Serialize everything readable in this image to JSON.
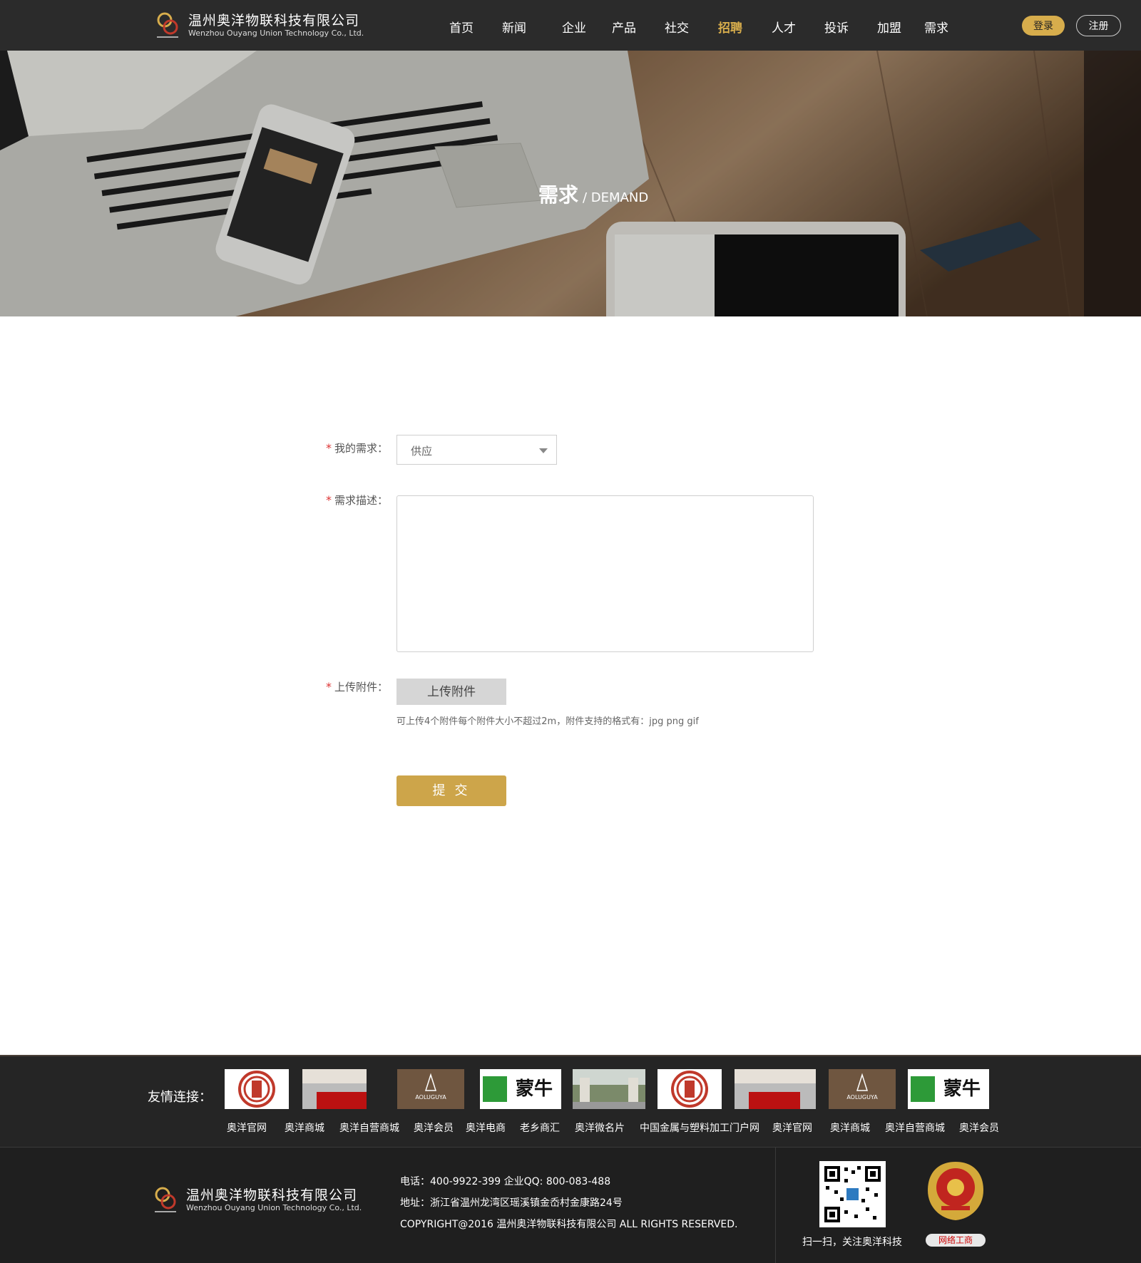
{
  "header": {
    "company_cn": "温州奥洋物联科技有限公司",
    "company_en": "Wenzhou Ouyang Union Technology Co., Ltd.",
    "nav": [
      {
        "label": "首页",
        "active": false
      },
      {
        "label": "新闻",
        "active": false
      },
      {
        "label": "企业",
        "active": false
      },
      {
        "label": "产品",
        "active": false
      },
      {
        "label": "社交",
        "active": false
      },
      {
        "label": "招聘",
        "active": true
      },
      {
        "label": "人才",
        "active": false
      },
      {
        "label": "投诉",
        "active": false
      },
      {
        "label": "加盟",
        "active": false
      },
      {
        "label": "需求",
        "active": false
      }
    ],
    "login_label": "登录",
    "register_label": "注册",
    "accent_color": "#d7ad4c"
  },
  "banner": {
    "title_cn": "需求",
    "title_en": "/ DEMAND"
  },
  "form": {
    "demand_label": "我的需求：",
    "demand_value": "供应",
    "description_label": "需求描述：",
    "description_value": "",
    "attachment_label": "上传附件：",
    "upload_button": "上传附件",
    "upload_hint": "可上传4个附件每个附件大小不超过2m，附件支持的格式有：jpg png gif",
    "submit_button": "提 交",
    "required_mark": "*"
  },
  "friend_links": {
    "title": "友情连接：",
    "logos": [
      "red-seal-logo",
      "banner-photo-logo",
      "aoluguya-logo",
      "mengniu-logo",
      "gate-photo-logo",
      "red-seal-logo",
      "banner-photo-logo",
      "aoluguya-logo",
      "mengniu-logo"
    ],
    "logo_texts": {
      "aoluguya": "AOLUGUYA",
      "mengniu": "蒙牛"
    },
    "labels": [
      "奥洋官网",
      "奥洋商城",
      "奥洋自营商城",
      "奥洋会员",
      "奥洋电商",
      "老乡商汇",
      "奥洋微名片",
      "中国金属与塑料加工门户网",
      "奥洋官网",
      "奥洋商城",
      "奥洋自营商城",
      "奥洋会员"
    ]
  },
  "footer": {
    "company_cn": "温州奥洋物联科技有限公司",
    "company_en": "Wenzhou Ouyang Union Technology Co., Ltd.",
    "phone_line": "电话：400-9922-399    企业QQ: 800-083-488",
    "address_line": "地址：浙江省温州龙湾区瑶溪镇金岙村金康路24号",
    "copyright_line": "COPYRIGHT@2016 温州奥洋物联科技有限公司 ALL RIGHTS RESERVED.",
    "qr_caption": "扫一扫，关注奥洋科技",
    "emblem_caption": "网络工商"
  }
}
